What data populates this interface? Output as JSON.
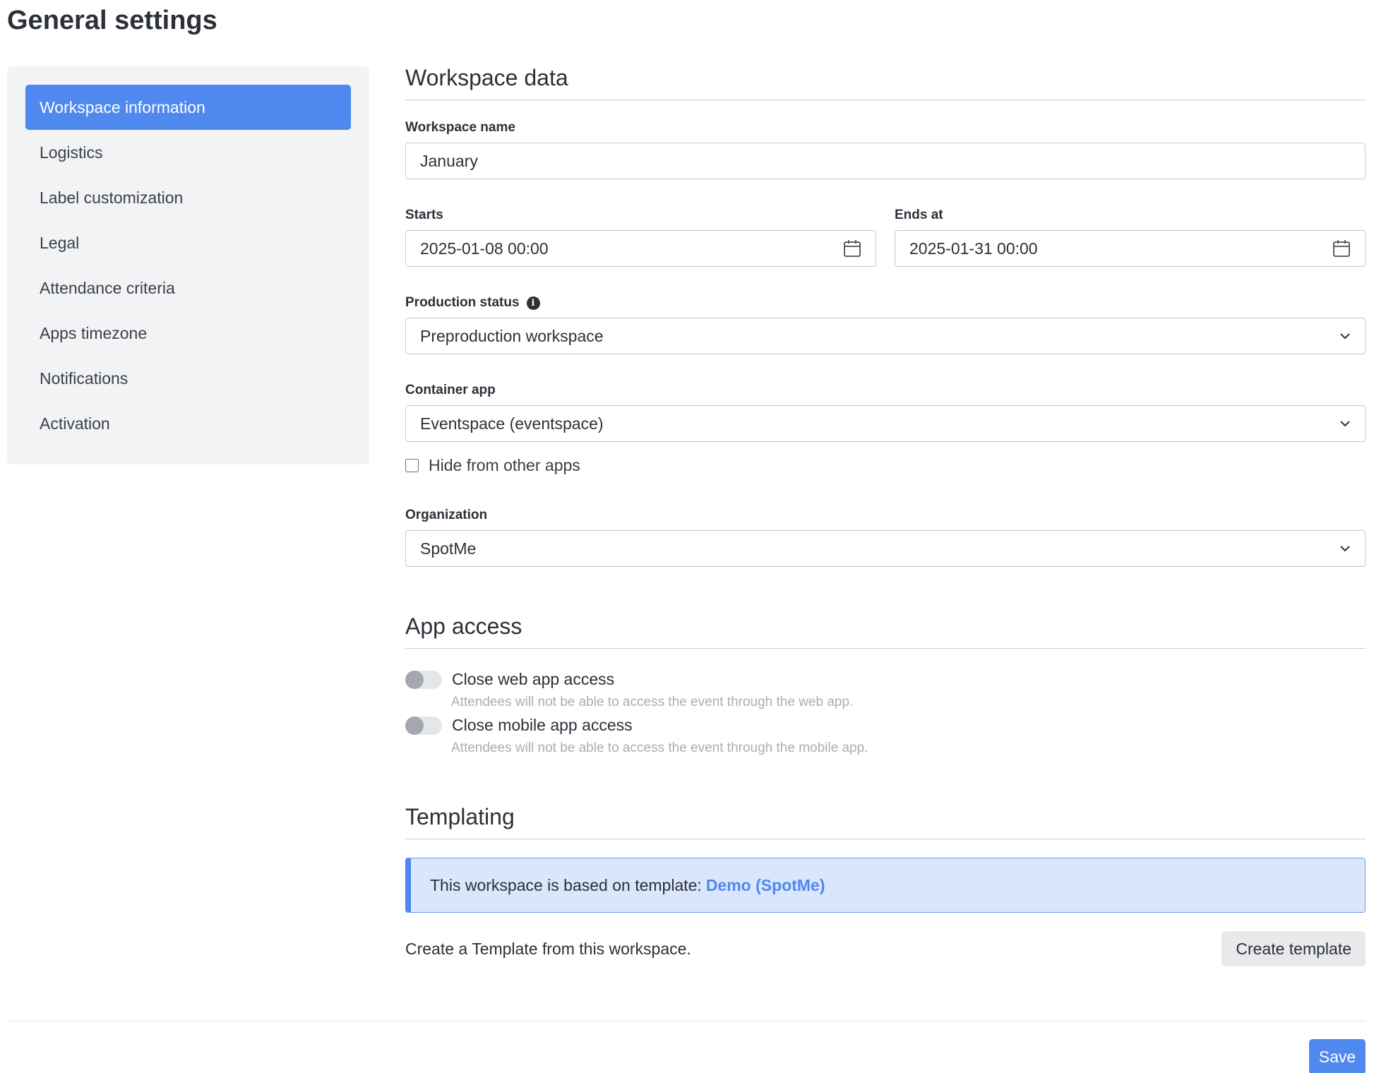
{
  "page": {
    "title": "General settings"
  },
  "sidebar": {
    "items": [
      {
        "label": "Workspace information",
        "active": true
      },
      {
        "label": "Logistics"
      },
      {
        "label": "Label customization"
      },
      {
        "label": "Legal"
      },
      {
        "label": "Attendance criteria"
      },
      {
        "label": "Apps timezone"
      },
      {
        "label": "Notifications"
      },
      {
        "label": "Activation"
      }
    ]
  },
  "workspace_data": {
    "title": "Workspace data",
    "name_label": "Workspace name",
    "name_value": "January",
    "starts_label": "Starts",
    "starts_value": "2025-01-08 00:00",
    "ends_label": "Ends at",
    "ends_value": "2025-01-31 00:00",
    "production_label": "Production status",
    "production_value": "Preproduction workspace",
    "container_label": "Container app",
    "container_value": "Eventspace (eventspace)",
    "hide_label": "Hide from other apps",
    "hide_checked": false,
    "organization_label": "Organization",
    "organization_value": "SpotMe"
  },
  "app_access": {
    "title": "App access",
    "web_label": "Close web app access",
    "web_hint": "Attendees will not be able to access the event through the web app.",
    "web_enabled": false,
    "mobile_label": "Close mobile app access",
    "mobile_hint": "Attendees will not be able to access the event through the mobile app.",
    "mobile_enabled": false
  },
  "templating": {
    "title": "Templating",
    "based_on_text": "This workspace is based on template:",
    "template_link": "Demo (SpotMe)",
    "create_text": "Create a Template from this workspace.",
    "create_button": "Create template"
  },
  "footer": {
    "save_button": "Save"
  },
  "colors": {
    "accent": "#4f88ee",
    "sidebar_bg": "#f2f3f5",
    "info_bg": "#dae6fc"
  }
}
